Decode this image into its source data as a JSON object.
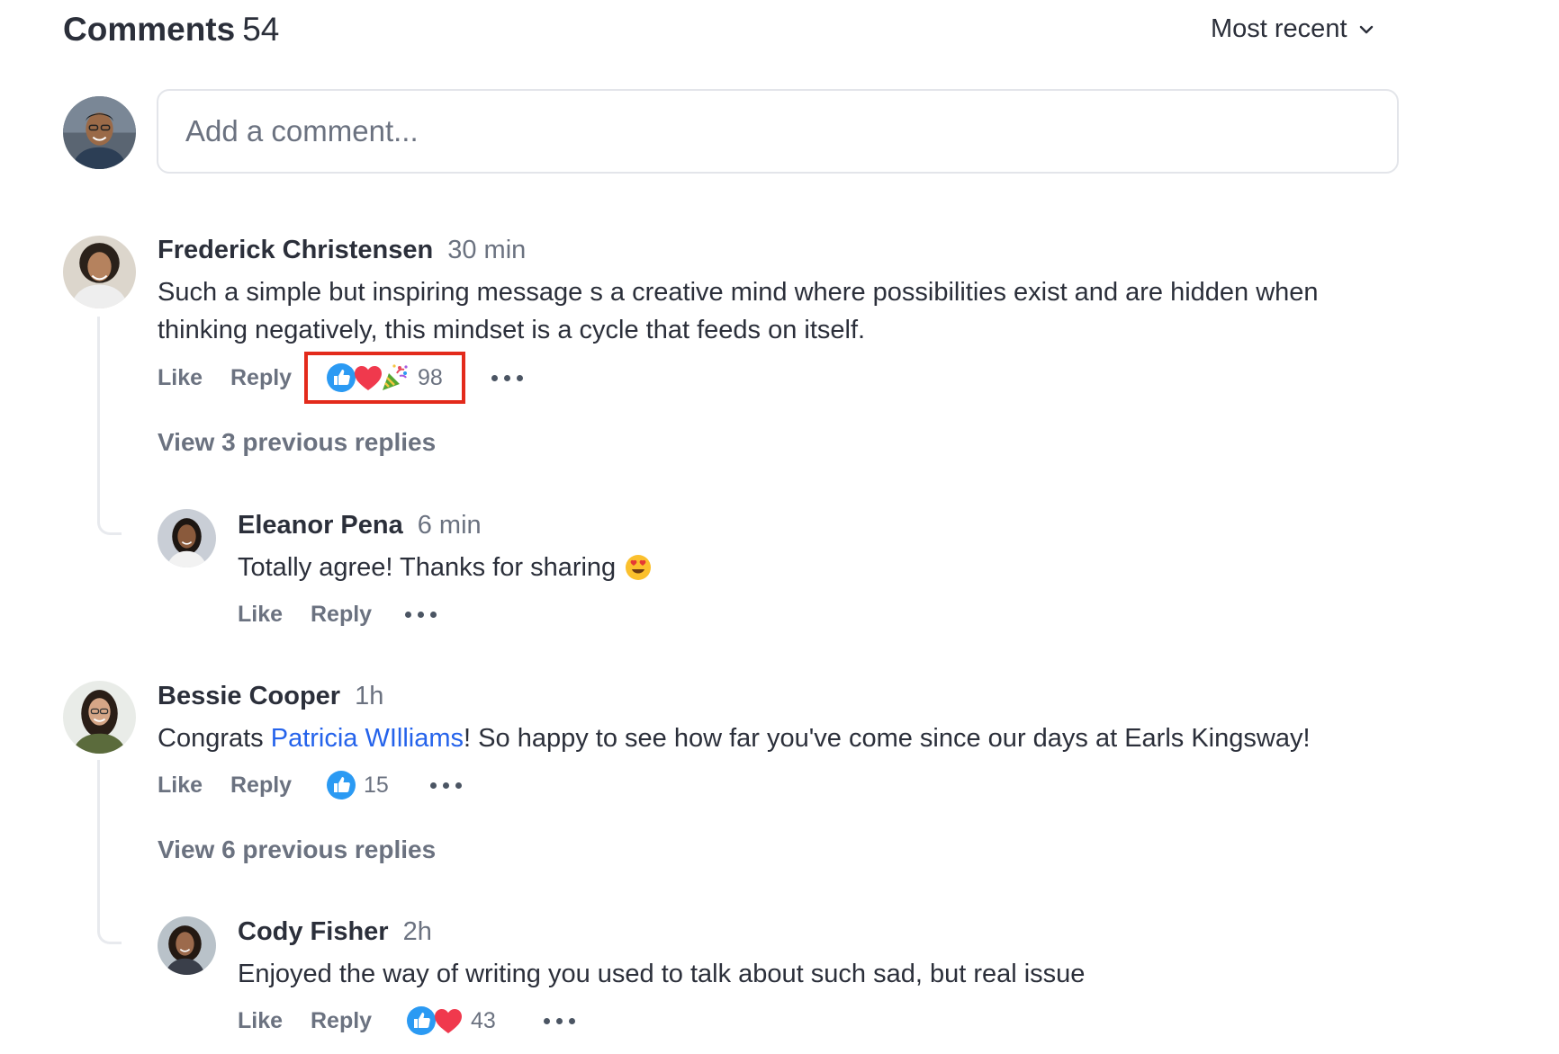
{
  "header": {
    "title": "Comments",
    "count": "54",
    "sort_label": "Most recent"
  },
  "composer": {
    "placeholder": "Add a comment..."
  },
  "actions": {
    "like": "Like",
    "reply": "Reply"
  },
  "comments": [
    {
      "author": "Frederick Christensen",
      "time": "30 min",
      "text_line1": "Such a simple but inspiring message s a creative mind where possibilities exist and are hidden when",
      "text_line2": "thinking negatively, this mindset is a cycle that feeds on itself.",
      "reactions": [
        "thumbs-up",
        "heart",
        "party-popper"
      ],
      "reaction_count": "98",
      "view_replies": "View 3 previous replies",
      "reply": {
        "author": "Eleanor Pena",
        "time": "6 min",
        "text": "Totally agree! Thanks for sharing",
        "emoji": "heart-eyes"
      }
    },
    {
      "author": "Bessie Cooper",
      "time": "1h",
      "text_before": "Congrats ",
      "mention": "Patricia WIlliams",
      "text_after": "! So happy to see how far you've come since our days at Earls Kingsway!",
      "reactions": [
        "thumbs-up"
      ],
      "reaction_count": "15",
      "view_replies": "View 6 previous replies",
      "reply": {
        "author": "Cody Fisher",
        "time": "2h",
        "text": "Enjoyed the way of writing you used to talk about such sad, but real issue",
        "reactions": [
          "thumbs-up",
          "heart"
        ],
        "reaction_count": "43"
      }
    }
  ],
  "colors": {
    "highlight": "#e32a1b",
    "mention": "#2563eb",
    "like_blue": "#1d9bf0",
    "heart_red": "#f0394d"
  }
}
